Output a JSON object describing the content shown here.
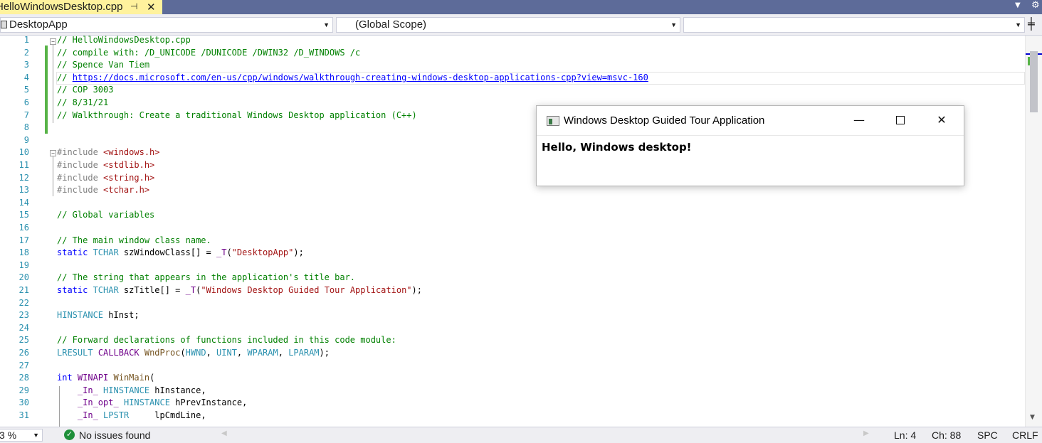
{
  "tab": {
    "title": "HelloWindowsDesktop.cpp",
    "pin_icon": "pin-icon",
    "close_icon": "close-icon"
  },
  "navbar": {
    "project": "DesktopApp",
    "scope": "(Global Scope)",
    "member": ""
  },
  "editor": {
    "lines": [
      {
        "n": "1",
        "parts": [
          {
            "c": "c",
            "t": "// HelloWindowsDesktop.cpp"
          }
        ]
      },
      {
        "n": "2",
        "parts": [
          {
            "c": "c",
            "t": "// compile with: /D_UNICODE /DUNICODE /DWIN32 /D_WINDOWS /c"
          }
        ]
      },
      {
        "n": "3",
        "parts": [
          {
            "c": "c",
            "t": "// Spence Van Tiem"
          }
        ]
      },
      {
        "n": "4",
        "parts": [
          {
            "c": "c",
            "t": "// "
          },
          {
            "c": "u",
            "t": "https://docs.microsoft.com/en-us/cpp/windows/walkthrough-creating-windows-desktop-applications-cpp?view=msvc-160"
          }
        ]
      },
      {
        "n": "5",
        "parts": [
          {
            "c": "c",
            "t": "// COP 3003"
          }
        ]
      },
      {
        "n": "6",
        "parts": [
          {
            "c": "c",
            "t": "// 8/31/21"
          }
        ]
      },
      {
        "n": "7",
        "parts": [
          {
            "c": "c",
            "t": "// Walkthrough: Create a traditional Windows Desktop application (C++)"
          }
        ]
      },
      {
        "n": "8",
        "parts": []
      },
      {
        "n": "9",
        "parts": []
      },
      {
        "n": "10",
        "parts": [
          {
            "c": "pp",
            "t": "#include "
          },
          {
            "c": "s",
            "t": "<windows.h>"
          }
        ]
      },
      {
        "n": "11",
        "parts": [
          {
            "c": "pp",
            "t": "#include "
          },
          {
            "c": "s",
            "t": "<stdlib.h>"
          }
        ]
      },
      {
        "n": "12",
        "parts": [
          {
            "c": "pp",
            "t": "#include "
          },
          {
            "c": "s",
            "t": "<string.h>"
          }
        ]
      },
      {
        "n": "13",
        "parts": [
          {
            "c": "pp",
            "t": "#include "
          },
          {
            "c": "s",
            "t": "<tchar.h>"
          }
        ]
      },
      {
        "n": "14",
        "parts": []
      },
      {
        "n": "15",
        "parts": [
          {
            "c": "c",
            "t": "// Global variables"
          }
        ]
      },
      {
        "n": "16",
        "parts": []
      },
      {
        "n": "17",
        "parts": [
          {
            "c": "c",
            "t": "// The main window class name."
          }
        ]
      },
      {
        "n": "18",
        "parts": [
          {
            "c": "k",
            "t": "static "
          },
          {
            "c": "t",
            "t": "TCHAR"
          },
          {
            "c": "",
            "t": " szWindowClass[] = "
          },
          {
            "c": "m",
            "t": "_T"
          },
          {
            "c": "",
            "t": "("
          },
          {
            "c": "s",
            "t": "\"DesktopApp\""
          },
          {
            "c": "",
            "t": ");"
          }
        ]
      },
      {
        "n": "19",
        "parts": []
      },
      {
        "n": "20",
        "parts": [
          {
            "c": "c",
            "t": "// The string that appears in the application's title bar."
          }
        ]
      },
      {
        "n": "21",
        "parts": [
          {
            "c": "k",
            "t": "static "
          },
          {
            "c": "t",
            "t": "TCHAR"
          },
          {
            "c": "",
            "t": " szTitle[] = "
          },
          {
            "c": "m",
            "t": "_T"
          },
          {
            "c": "",
            "t": "("
          },
          {
            "c": "s",
            "t": "\"Windows Desktop Guided Tour Application\""
          },
          {
            "c": "",
            "t": ");"
          }
        ]
      },
      {
        "n": "22",
        "parts": []
      },
      {
        "n": "23",
        "parts": [
          {
            "c": "t",
            "t": "HINSTANCE"
          },
          {
            "c": "",
            "t": " hInst;"
          }
        ]
      },
      {
        "n": "24",
        "parts": []
      },
      {
        "n": "25",
        "parts": [
          {
            "c": "c",
            "t": "// Forward declarations of functions included in this code module:"
          }
        ]
      },
      {
        "n": "26",
        "parts": [
          {
            "c": "t",
            "t": "LRESULT"
          },
          {
            "c": "",
            "t": " "
          },
          {
            "c": "m",
            "t": "CALLBACK"
          },
          {
            "c": "",
            "t": " "
          },
          {
            "c": "f",
            "t": "WndProc"
          },
          {
            "c": "",
            "t": "("
          },
          {
            "c": "t",
            "t": "HWND"
          },
          {
            "c": "",
            "t": ", "
          },
          {
            "c": "t",
            "t": "UINT"
          },
          {
            "c": "",
            "t": ", "
          },
          {
            "c": "t",
            "t": "WPARAM"
          },
          {
            "c": "",
            "t": ", "
          },
          {
            "c": "t",
            "t": "LPARAM"
          },
          {
            "c": "",
            "t": ");"
          }
        ]
      },
      {
        "n": "27",
        "parts": []
      },
      {
        "n": "28",
        "parts": [
          {
            "c": "k",
            "t": "int "
          },
          {
            "c": "m",
            "t": "WINAPI"
          },
          {
            "c": "",
            "t": " "
          },
          {
            "c": "f",
            "t": "WinMain"
          },
          {
            "c": "",
            "t": "("
          }
        ]
      },
      {
        "n": "29",
        "parts": [
          {
            "c": "",
            "t": "    "
          },
          {
            "c": "m",
            "t": "_In_"
          },
          {
            "c": "",
            "t": " "
          },
          {
            "c": "t",
            "t": "HINSTANCE"
          },
          {
            "c": "",
            "t": " hInstance,"
          }
        ]
      },
      {
        "n": "30",
        "parts": [
          {
            "c": "",
            "t": "    "
          },
          {
            "c": "m",
            "t": "_In_opt_"
          },
          {
            "c": "",
            "t": " "
          },
          {
            "c": "t",
            "t": "HINSTANCE"
          },
          {
            "c": "",
            "t": " hPrevInstance,"
          }
        ]
      },
      {
        "n": "31",
        "parts": [
          {
            "c": "",
            "t": "    "
          },
          {
            "c": "m",
            "t": "_In_"
          },
          {
            "c": "",
            "t": " "
          },
          {
            "c": "t",
            "t": "LPSTR"
          },
          {
            "c": "",
            "t": "     lpCmdLine,"
          }
        ]
      }
    ]
  },
  "status": {
    "zoom": "3 %",
    "issues": "No issues found",
    "line": "Ln: 4",
    "col": "Ch: 88",
    "whitespace": "SPC",
    "eol": "CRLF"
  },
  "app_window": {
    "title": "Windows Desktop Guided Tour Application",
    "message": "Hello, Windows desktop!",
    "minimize": "—",
    "close": "✕"
  },
  "colors": {
    "tab_active": "#fff29d",
    "tab_strip": "#5d6b99",
    "comment": "#008000",
    "line_number": "#2b91af",
    "change_bar": "#57b347"
  }
}
